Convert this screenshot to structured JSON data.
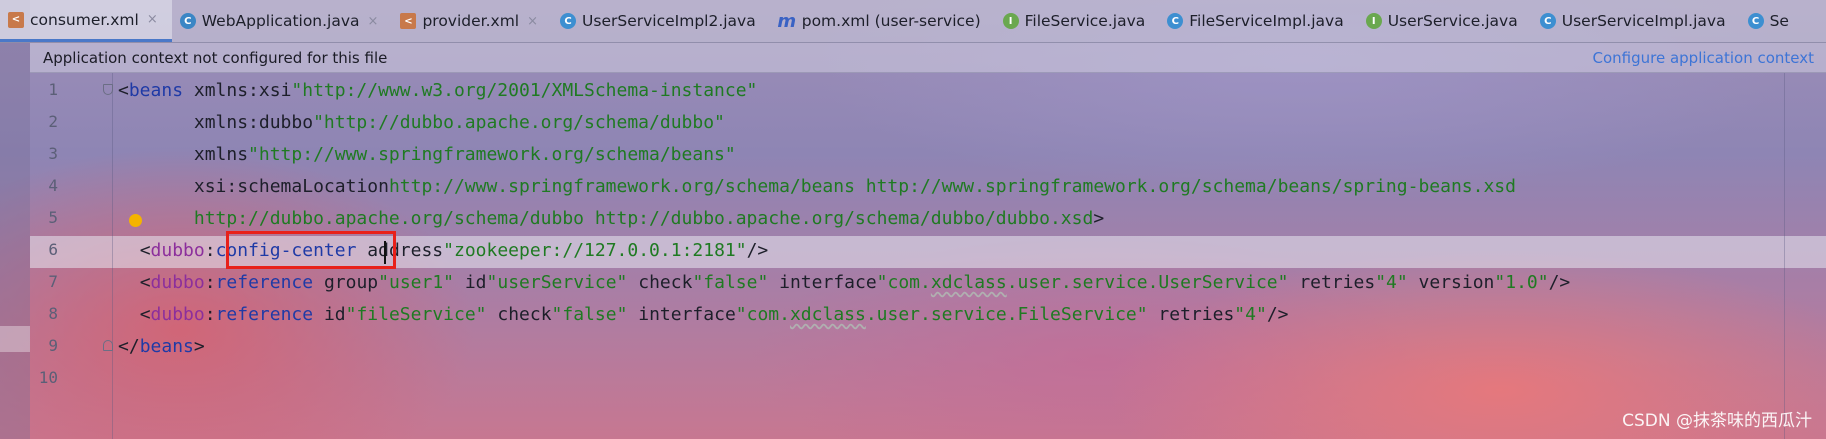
{
  "tabs": [
    {
      "label": "consumer.xml",
      "icon": "xml-file-icon",
      "active": true
    },
    {
      "label": "WebApplication.java",
      "icon": "spring-class-icon",
      "active": false
    },
    {
      "label": "provider.xml",
      "icon": "xml-file-icon",
      "active": false
    },
    {
      "label": "UserServiceImpl2.java",
      "icon": "class-icon",
      "active": false
    },
    {
      "label": "pom.xml (user-service)",
      "icon": "maven-icon",
      "active": false
    },
    {
      "label": "FileService.java",
      "icon": "interface-icon",
      "active": false
    },
    {
      "label": "FileServiceImpl.java",
      "icon": "class-icon",
      "active": false
    },
    {
      "label": "UserService.java",
      "icon": "interface-icon",
      "active": false
    },
    {
      "label": "UserServiceImpl.java",
      "icon": "class-icon",
      "active": false
    },
    {
      "label": "Se",
      "icon": "class-icon",
      "active": false
    }
  ],
  "notice": {
    "message": "Application context not configured for this file",
    "action": "Configure application context"
  },
  "editor": {
    "line_numbers": [
      "1",
      "2",
      "3",
      "4",
      "5",
      "6",
      "7",
      "8",
      "9",
      "10"
    ],
    "current_line": "6",
    "lines": [
      "<beans xmlns:xsi=\"http://www.w3.org/2001/XMLSchema-instance\"",
      "       xmlns:dubbo=\"http://dubbo.apache.org/schema/dubbo\"",
      "       xmlns=\"http://www.springframework.org/schema/beans\"",
      "       xsi:schemaLocation=\"http://www.springframework.org/schema/beans http://www.springframework.org/schema/beans/spring-beans.xsd",
      "       http://dubbo.apache.org/schema/dubbo http://dubbo.apache.org/schema/dubbo/dubbo.xsd\">",
      "  <dubbo:config-center address=\"zookeeper://127.0.0.1:2181\"/>",
      "  <dubbo:reference group=\"user1\" id=\"userService\" check=\"false\" interface=\"com.xdclass.user.service.UserService\" retries=\"4\" version=\"1.0\"/>",
      "  <dubbo:reference id=\"fileService\" check=\"false\" interface=\"com.xdclass.user.service.FileService\" retries=\"4\"/>",
      "</beans>",
      ""
    ],
    "highlighted_token": "config-center"
  },
  "colors": {
    "tag": "#1f3aa6",
    "namespace": "#8c2f9c",
    "attribute": "#1f5cd8",
    "value": "#1f7a22",
    "highlight_box": "#e8211a",
    "bulb": "#f4b400"
  },
  "watermark": "CSDN @抹茶味的西瓜汁"
}
